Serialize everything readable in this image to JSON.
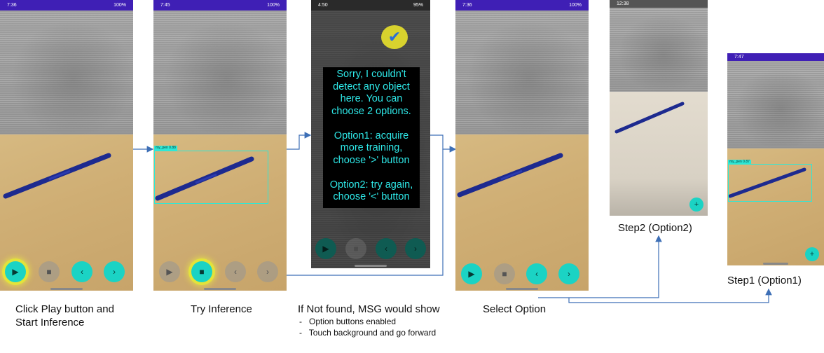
{
  "colors": {
    "accent": "#1bd3c4",
    "status_bar": "#3f1fb5",
    "highlight": "#e3e33a",
    "arrow": "#3d6fb6",
    "bbox": "#2ee8d6"
  },
  "panels": [
    {
      "id": "p1",
      "status_time": "7:36",
      "status_sys": "100%",
      "caption": "Click Play button and\nStart Inference"
    },
    {
      "id": "p2",
      "status_time": "7:45",
      "status_sys": "100%",
      "bbox_label": "my_pen 0.88",
      "caption": "Try Inference"
    },
    {
      "id": "p3",
      "status_time": "4:50",
      "status_sys": "95%",
      "caption": "If Not found, MSG would show",
      "bullets": [
        "-   Option buttons enabled",
        "-   Touch background and go forward"
      ],
      "message": [
        "Sorry, I couldn't",
        "detect any object",
        "here. You can",
        "choose 2 options.",
        "",
        "Option1: acquire",
        "more training,",
        "choose '>' button",
        "",
        "Option2: try again,",
        "choose '<' button"
      ]
    },
    {
      "id": "p4",
      "status_time": "7:36",
      "status_sys": "100%",
      "caption": "Select Option"
    },
    {
      "id": "p5",
      "status_time": "12:38",
      "status_sys": "",
      "caption": "Step2 (Option2)"
    },
    {
      "id": "p6",
      "status_time": "7:47",
      "status_sys": "",
      "bbox_label": "my_pen 0.87",
      "caption": "Step1 (Option1)"
    }
  ],
  "controls": {
    "play_icon": "▶",
    "stop_icon": "■",
    "back_icon": "‹",
    "forward_icon": "›",
    "add_icon": "+",
    "check_icon": "✔"
  }
}
